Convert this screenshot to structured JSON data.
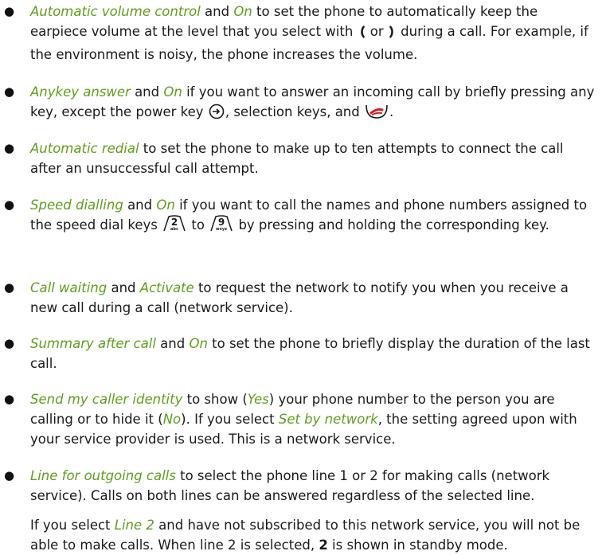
{
  "items": [
    {
      "term": "Automatic volume control",
      "and": " and ",
      "opt": "On",
      "t1": " to set the phone to automatically keep the earpiece volume at the level that you select with ",
      "or": " or ",
      "t2": " during a call. For example, if the environment is noisy, the phone increases the volume."
    },
    {
      "term": "Anykey answer",
      "and": " and ",
      "opt": "On",
      "t1": " if you want to answer an incoming call by briefly pressing any key, except the power key ",
      "t2": ", selection keys, and ",
      "t3": "."
    },
    {
      "term": "Automatic redial",
      "t1": " to set the phone to make up to ten attempts to connect the call after an unsuccessful call attempt."
    },
    {
      "term": "Speed dialling",
      "and": " and ",
      "opt": "On",
      "t1": " if you want to call the names and phone numbers assigned to the speed dial keys ",
      "to": " to ",
      "t2": " by pressing and holding the corresponding key.",
      "key_a_digit": "2",
      "key_a_letters": "abc",
      "key_b_digit": "9",
      "key_b_letters": "wxyz"
    },
    {
      "term": "Call waiting",
      "and": " and ",
      "opt": "Activate",
      "t1": " to request the network to notify you when you receive a new call during a call (network service)."
    },
    {
      "term": "Summary after call",
      "and": " and ",
      "opt": "On",
      "t1": " to set the phone to briefly display the duration of the last call."
    },
    {
      "term": "Send my caller identity",
      "t1": " to show (",
      "yes": "Yes",
      "t2": ") your phone number to the person you are calling or to hide it (",
      "no": "No",
      "t3": "). If you select ",
      "set": "Set by network",
      "t4": ", the setting agreed upon with your service provider is used. This is a network service."
    },
    {
      "term": "Line for outgoing calls",
      "t1": " to select the phone line 1 or 2 for making calls (network service). Calls on both lines can be answered regardless of the selected line.",
      "p2a": "If you select ",
      "line2": "Line 2",
      "p2b": " and have not subscribed to this network service, you will not be able to make calls. When line 2 is selected, ",
      "bold2": "2",
      "p2c": " is shown in standby mode."
    }
  ],
  "colors": {
    "accent": "#5f9e1e",
    "text": "#1a1a1a"
  },
  "icons": [
    "volume-left-icon",
    "volume-right-icon",
    "power-key-icon",
    "end-call-key-icon",
    "key-2-icon",
    "key-9-icon"
  ]
}
